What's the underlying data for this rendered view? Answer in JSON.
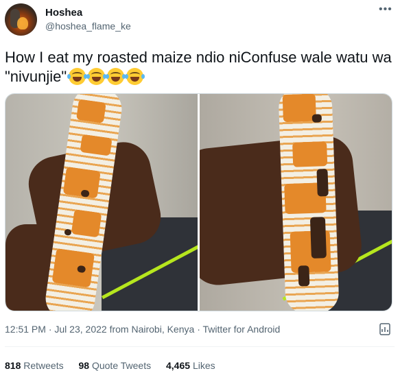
{
  "author": {
    "name": "Hoshea",
    "handle": "@hoshea_flame_ke",
    "avatar_icon": "profile-avatar"
  },
  "more_icon": "more-options-icon",
  "tweet": {
    "text": "How I eat my roasted maize ndio niConfuse wale watu wa \"nivunjie\"",
    "emojis": [
      "face-with-tears-of-joy",
      "face-with-tears-of-joy",
      "face-with-tears-of-joy",
      "face-with-tears-of-joy"
    ]
  },
  "media": [
    {
      "name": "photo-left",
      "icon": "photo"
    },
    {
      "name": "photo-right",
      "icon": "photo"
    }
  ],
  "meta": {
    "time": "12:51 PM",
    "date": "Jul 23, 2022",
    "location": "from Nairobi, Kenya",
    "client": "Twitter for Android",
    "separator": "·"
  },
  "stats": {
    "retweets_count": "818",
    "retweets_label": "Retweets",
    "quotes_count": "98",
    "quotes_label": "Quote Tweets",
    "likes_count": "4,465",
    "likes_label": "Likes"
  },
  "colors": {
    "text_primary": "#0f1419",
    "text_secondary": "#536471",
    "border": "#cfd9de",
    "emoji_yellow": "#ffcc33"
  }
}
